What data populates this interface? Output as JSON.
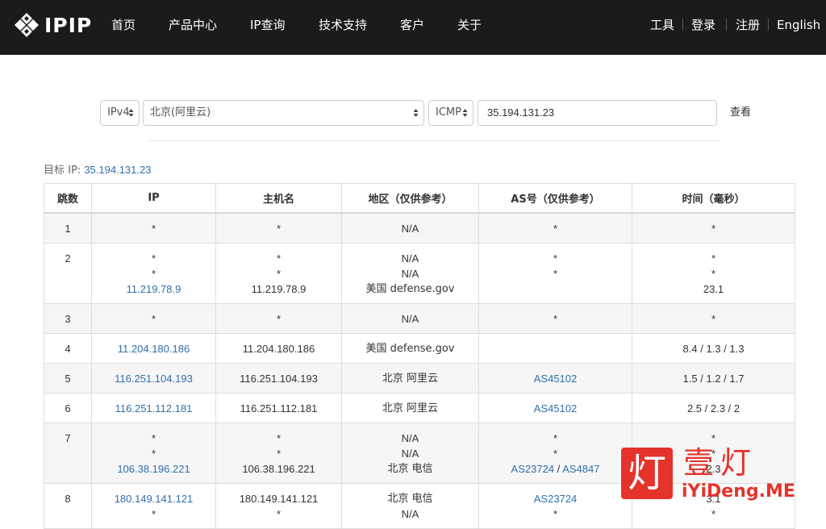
{
  "header": {
    "logo_text": "IPIP",
    "nav": [
      "首页",
      "产品中心",
      "IP查询",
      "技术支持",
      "客户",
      "关于"
    ],
    "right_nav": [
      "工具",
      "登录",
      "注册",
      "English"
    ]
  },
  "form": {
    "ip_version": "IPv4",
    "node": "北京(阿里云)",
    "protocol": "ICMP",
    "target_value": "35.194.131.23",
    "submit_label": "查看"
  },
  "target": {
    "label": "目标 IP:",
    "value": "35.194.131.23"
  },
  "table": {
    "headers": [
      "跳数",
      "IP",
      "主机名",
      "地区（仅供参考）",
      "AS号（仅供参考）",
      "时间（毫秒）"
    ],
    "rows": [
      {
        "hop": "1",
        "ip": [
          "*"
        ],
        "host": [
          "*"
        ],
        "region": [
          "N/A"
        ],
        "as": [
          "*"
        ],
        "time": [
          "*"
        ]
      },
      {
        "hop": "2",
        "ip": [
          "*",
          "*",
          "11.219.78.9"
        ],
        "host": [
          "*",
          "*",
          "11.219.78.9"
        ],
        "region": [
          "N/A",
          "N/A",
          "美国 defense.gov"
        ],
        "as": [
          "*",
          "*",
          ""
        ],
        "time": [
          "*",
          "*",
          "23.1"
        ]
      },
      {
        "hop": "3",
        "ip": [
          "*"
        ],
        "host": [
          "*"
        ],
        "region": [
          "N/A"
        ],
        "as": [
          "*"
        ],
        "time": [
          "*"
        ]
      },
      {
        "hop": "4",
        "ip": [
          "11.204.180.186"
        ],
        "host": [
          "11.204.180.186"
        ],
        "region": [
          "美国 defense.gov"
        ],
        "as": [
          ""
        ],
        "time": [
          "8.4 / 1.3 / 1.3"
        ]
      },
      {
        "hop": "5",
        "ip": [
          "116.251.104.193"
        ],
        "host": [
          "116.251.104.193"
        ],
        "region": [
          "北京 阿里云"
        ],
        "as": [
          "AS45102"
        ],
        "time": [
          "1.5 / 1.2 / 1.7"
        ]
      },
      {
        "hop": "6",
        "ip": [
          "116.251.112.181"
        ],
        "host": [
          "116.251.112.181"
        ],
        "region": [
          "北京 阿里云"
        ],
        "as": [
          "AS45102"
        ],
        "time": [
          "2.5 / 2.3 / 2"
        ]
      },
      {
        "hop": "7",
        "ip": [
          "*",
          "*",
          "106.38.196.221"
        ],
        "host": [
          "*",
          "*",
          "106.38.196.221"
        ],
        "region": [
          "N/A",
          "N/A",
          "北京 电信"
        ],
        "as": [
          "*",
          "*",
          "AS23724 / AS4847"
        ],
        "time": [
          "*",
          "*",
          "2.3"
        ]
      },
      {
        "hop": "8",
        "ip": [
          "180.149.141.121",
          "*"
        ],
        "host": [
          "180.149.141.121",
          "*"
        ],
        "region": [
          "北京 电信",
          "N/A"
        ],
        "as": [
          "AS23724",
          "*"
        ],
        "time": [
          "3.1",
          "*"
        ]
      }
    ]
  },
  "watermark": {
    "glyph": "灯",
    "title": "壹灯",
    "subtitle": "iYiDeng.ME"
  },
  "colors": {
    "header_bg": "#1b1b1b",
    "link": "#2f6fab",
    "row_alt": "#f6f6f6",
    "watermark": "#e4332b"
  }
}
